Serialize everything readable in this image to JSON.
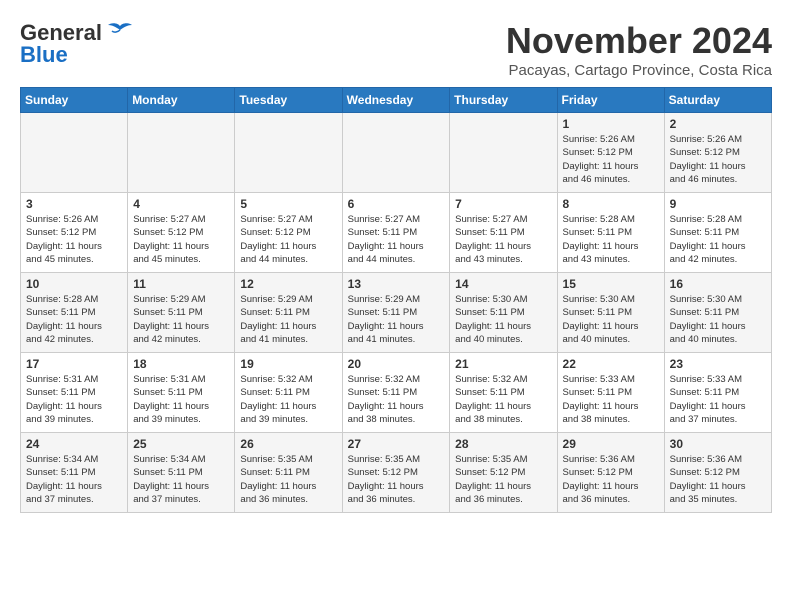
{
  "header": {
    "logo_general": "General",
    "logo_blue": "Blue",
    "month_title": "November 2024",
    "subtitle": "Pacayas, Cartago Province, Costa Rica"
  },
  "weekdays": [
    "Sunday",
    "Monday",
    "Tuesday",
    "Wednesday",
    "Thursday",
    "Friday",
    "Saturday"
  ],
  "weeks": [
    [
      {
        "day": "",
        "info": ""
      },
      {
        "day": "",
        "info": ""
      },
      {
        "day": "",
        "info": ""
      },
      {
        "day": "",
        "info": ""
      },
      {
        "day": "",
        "info": ""
      },
      {
        "day": "1",
        "info": "Sunrise: 5:26 AM\nSunset: 5:12 PM\nDaylight: 11 hours\nand 46 minutes."
      },
      {
        "day": "2",
        "info": "Sunrise: 5:26 AM\nSunset: 5:12 PM\nDaylight: 11 hours\nand 46 minutes."
      }
    ],
    [
      {
        "day": "3",
        "info": "Sunrise: 5:26 AM\nSunset: 5:12 PM\nDaylight: 11 hours\nand 45 minutes."
      },
      {
        "day": "4",
        "info": "Sunrise: 5:27 AM\nSunset: 5:12 PM\nDaylight: 11 hours\nand 45 minutes."
      },
      {
        "day": "5",
        "info": "Sunrise: 5:27 AM\nSunset: 5:12 PM\nDaylight: 11 hours\nand 44 minutes."
      },
      {
        "day": "6",
        "info": "Sunrise: 5:27 AM\nSunset: 5:11 PM\nDaylight: 11 hours\nand 44 minutes."
      },
      {
        "day": "7",
        "info": "Sunrise: 5:27 AM\nSunset: 5:11 PM\nDaylight: 11 hours\nand 43 minutes."
      },
      {
        "day": "8",
        "info": "Sunrise: 5:28 AM\nSunset: 5:11 PM\nDaylight: 11 hours\nand 43 minutes."
      },
      {
        "day": "9",
        "info": "Sunrise: 5:28 AM\nSunset: 5:11 PM\nDaylight: 11 hours\nand 42 minutes."
      }
    ],
    [
      {
        "day": "10",
        "info": "Sunrise: 5:28 AM\nSunset: 5:11 PM\nDaylight: 11 hours\nand 42 minutes."
      },
      {
        "day": "11",
        "info": "Sunrise: 5:29 AM\nSunset: 5:11 PM\nDaylight: 11 hours\nand 42 minutes."
      },
      {
        "day": "12",
        "info": "Sunrise: 5:29 AM\nSunset: 5:11 PM\nDaylight: 11 hours\nand 41 minutes."
      },
      {
        "day": "13",
        "info": "Sunrise: 5:29 AM\nSunset: 5:11 PM\nDaylight: 11 hours\nand 41 minutes."
      },
      {
        "day": "14",
        "info": "Sunrise: 5:30 AM\nSunset: 5:11 PM\nDaylight: 11 hours\nand 40 minutes."
      },
      {
        "day": "15",
        "info": "Sunrise: 5:30 AM\nSunset: 5:11 PM\nDaylight: 11 hours\nand 40 minutes."
      },
      {
        "day": "16",
        "info": "Sunrise: 5:30 AM\nSunset: 5:11 PM\nDaylight: 11 hours\nand 40 minutes."
      }
    ],
    [
      {
        "day": "17",
        "info": "Sunrise: 5:31 AM\nSunset: 5:11 PM\nDaylight: 11 hours\nand 39 minutes."
      },
      {
        "day": "18",
        "info": "Sunrise: 5:31 AM\nSunset: 5:11 PM\nDaylight: 11 hours\nand 39 minutes."
      },
      {
        "day": "19",
        "info": "Sunrise: 5:32 AM\nSunset: 5:11 PM\nDaylight: 11 hours\nand 39 minutes."
      },
      {
        "day": "20",
        "info": "Sunrise: 5:32 AM\nSunset: 5:11 PM\nDaylight: 11 hours\nand 38 minutes."
      },
      {
        "day": "21",
        "info": "Sunrise: 5:32 AM\nSunset: 5:11 PM\nDaylight: 11 hours\nand 38 minutes."
      },
      {
        "day": "22",
        "info": "Sunrise: 5:33 AM\nSunset: 5:11 PM\nDaylight: 11 hours\nand 38 minutes."
      },
      {
        "day": "23",
        "info": "Sunrise: 5:33 AM\nSunset: 5:11 PM\nDaylight: 11 hours\nand 37 minutes."
      }
    ],
    [
      {
        "day": "24",
        "info": "Sunrise: 5:34 AM\nSunset: 5:11 PM\nDaylight: 11 hours\nand 37 minutes."
      },
      {
        "day": "25",
        "info": "Sunrise: 5:34 AM\nSunset: 5:11 PM\nDaylight: 11 hours\nand 37 minutes."
      },
      {
        "day": "26",
        "info": "Sunrise: 5:35 AM\nSunset: 5:11 PM\nDaylight: 11 hours\nand 36 minutes."
      },
      {
        "day": "27",
        "info": "Sunrise: 5:35 AM\nSunset: 5:12 PM\nDaylight: 11 hours\nand 36 minutes."
      },
      {
        "day": "28",
        "info": "Sunrise: 5:35 AM\nSunset: 5:12 PM\nDaylight: 11 hours\nand 36 minutes."
      },
      {
        "day": "29",
        "info": "Sunrise: 5:36 AM\nSunset: 5:12 PM\nDaylight: 11 hours\nand 36 minutes."
      },
      {
        "day": "30",
        "info": "Sunrise: 5:36 AM\nSunset: 5:12 PM\nDaylight: 11 hours\nand 35 minutes."
      }
    ]
  ]
}
